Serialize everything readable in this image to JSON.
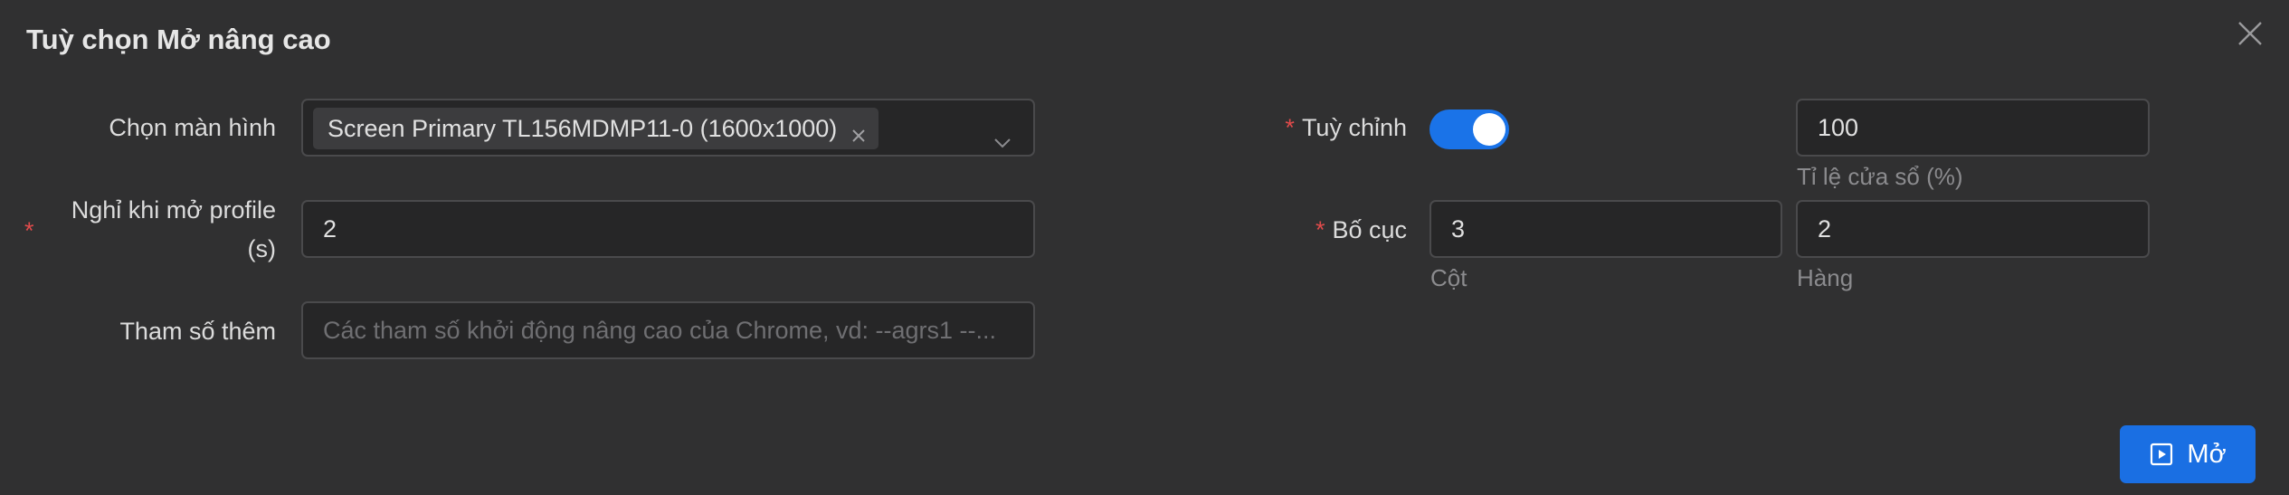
{
  "dialog": {
    "title": "Tuỳ chọn Mở nâng cao"
  },
  "left": {
    "screen": {
      "label": "Chọn màn hình",
      "tag": "Screen Primary TL156MDMP11-0 (1600x1000)"
    },
    "delay": {
      "label_line1": "Nghỉ khi mở profile",
      "label_line2": "(s)",
      "required_mark": "*",
      "value": "2"
    },
    "params": {
      "label": "Tham số thêm",
      "placeholder": "Các tham số khởi động nâng cao của Chrome, vd: --agrs1 --..."
    }
  },
  "right": {
    "custom": {
      "required_mark": "*",
      "label": "Tuỳ chỉnh",
      "enabled": true
    },
    "scale": {
      "value": "100",
      "hint": "Tỉ lệ cửa sổ (%)"
    },
    "layout": {
      "required_mark": "*",
      "label": "Bố cục",
      "columns_value": "3",
      "columns_hint": "Cột",
      "rows_value": "2",
      "rows_hint": "Hàng"
    }
  },
  "footer": {
    "open_label": "Mở"
  },
  "colors": {
    "accent": "#1a73e8",
    "required": "#e04b4b",
    "background": "#303031"
  }
}
